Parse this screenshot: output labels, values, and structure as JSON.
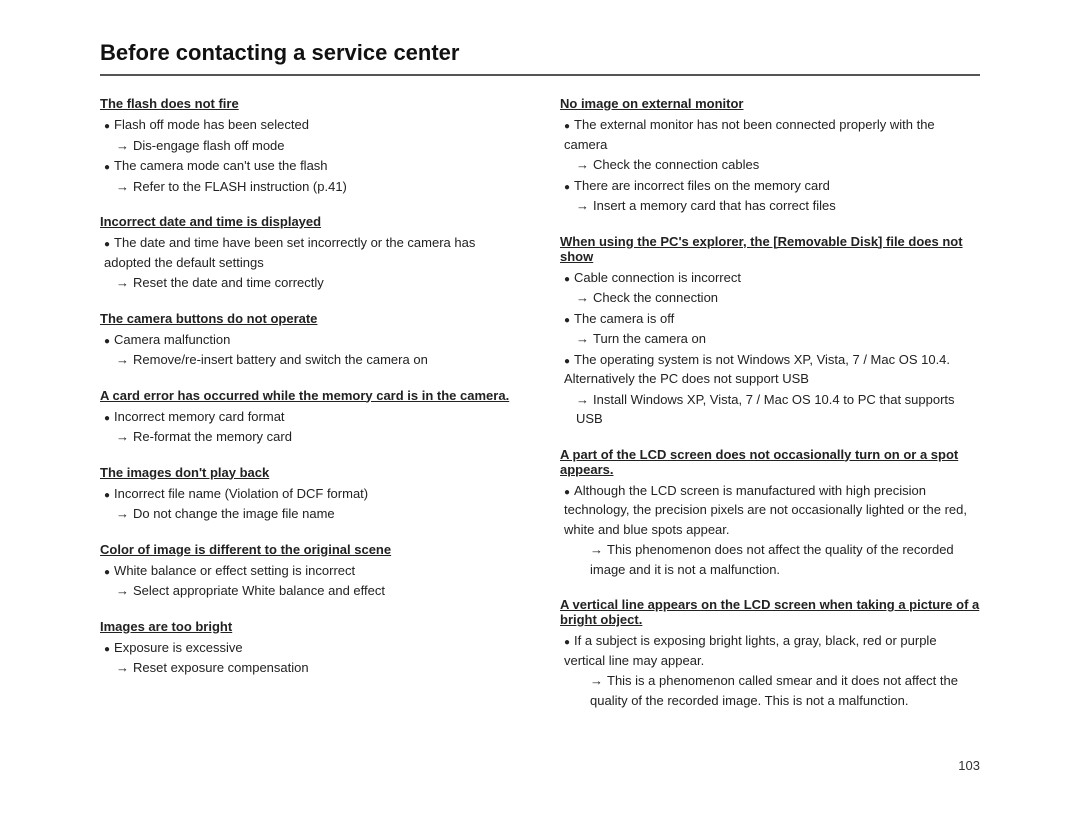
{
  "page": {
    "title": "Before contacting a service center",
    "page_number": "103"
  },
  "left_column": [
    {
      "id": "flash",
      "title": "The flash does not fire",
      "items": [
        {
          "type": "bullet",
          "text": "Flash off mode has been selected"
        },
        {
          "type": "arrow",
          "text": "Dis-engage flash off mode"
        },
        {
          "type": "bullet",
          "text": "The camera mode can't use the flash"
        },
        {
          "type": "arrow",
          "text": "Refer to the FLASH instruction (p.41)"
        }
      ]
    },
    {
      "id": "date",
      "title": "Incorrect date and time is displayed",
      "items": [
        {
          "type": "bullet",
          "text": "The date and time have been set incorrectly or the camera has adopted the default settings"
        },
        {
          "type": "arrow",
          "text": "Reset the date and time correctly"
        }
      ]
    },
    {
      "id": "buttons",
      "title": "The camera buttons do not operate",
      "items": [
        {
          "type": "bullet",
          "text": "Camera malfunction"
        },
        {
          "type": "arrow",
          "text": "Remove/re-insert battery and switch the camera on"
        }
      ]
    },
    {
      "id": "card-error",
      "title": "A card error has occurred while the memory card is in the camera.",
      "items": [
        {
          "type": "bullet",
          "text": "Incorrect memory card format"
        },
        {
          "type": "arrow",
          "text": "Re-format the memory card"
        }
      ]
    },
    {
      "id": "playback",
      "title": "The images don't play back",
      "items": [
        {
          "type": "bullet",
          "text": "Incorrect file name (Violation of DCF format)"
        },
        {
          "type": "arrow",
          "text": "Do not change the image file name"
        }
      ]
    },
    {
      "id": "color",
      "title": "Color of image is different to the original scene",
      "items": [
        {
          "type": "bullet",
          "text": "White balance or effect setting is incorrect"
        },
        {
          "type": "arrow",
          "text": "Select appropriate White balance and effect"
        }
      ]
    },
    {
      "id": "bright",
      "title": "Images are too bright",
      "items": [
        {
          "type": "bullet",
          "text": "Exposure is excessive"
        },
        {
          "type": "arrow",
          "text": "Reset exposure compensation"
        }
      ]
    }
  ],
  "right_column": [
    {
      "id": "no-image",
      "title": "No image on external monitor",
      "items": [
        {
          "type": "bullet",
          "text": "The external monitor has not been connected properly with the camera"
        },
        {
          "type": "arrow",
          "text": "Check the connection cables"
        },
        {
          "type": "bullet",
          "text": "There are incorrect files on the memory card"
        },
        {
          "type": "arrow",
          "text": "Insert a memory card that has correct files"
        }
      ]
    },
    {
      "id": "removable-disk",
      "title": "When using the PC's explorer, the [Removable Disk] file does not show",
      "items": [
        {
          "type": "bullet",
          "text": "Cable connection is incorrect"
        },
        {
          "type": "arrow",
          "text": "Check the connection"
        },
        {
          "type": "bullet",
          "text": "The camera is off"
        },
        {
          "type": "arrow",
          "text": "Turn the camera on"
        },
        {
          "type": "bullet",
          "text": "The operating system is not Windows XP, Vista, 7 / Mac OS 10.4. Alternatively the PC does not support USB"
        },
        {
          "type": "arrow",
          "text": "Install Windows XP, Vista, 7 / Mac OS 10.4 to PC that supports USB"
        }
      ]
    },
    {
      "id": "lcd-spot",
      "title": "A part of the LCD screen does not occasionally turn on or a spot appears.",
      "items": [
        {
          "type": "bullet",
          "text": "Although the LCD screen is manufactured with high precision technology, the precision pixels are not occasionally lighted or the red, white and blue spots appear."
        },
        {
          "type": "sub-arrow",
          "text": "This phenomenon does not affect the quality of the recorded image and it is not a malfunction."
        }
      ]
    },
    {
      "id": "vertical-line",
      "title": "A vertical line appears on the LCD screen when taking a picture of a bright object.",
      "items": [
        {
          "type": "bullet",
          "text": "If a subject is exposing bright lights, a gray, black, red or purple vertical line may appear."
        },
        {
          "type": "sub-arrow",
          "text": "This is a phenomenon called smear and it does not affect the quality of the recorded image. This is not a malfunction."
        }
      ]
    }
  ]
}
